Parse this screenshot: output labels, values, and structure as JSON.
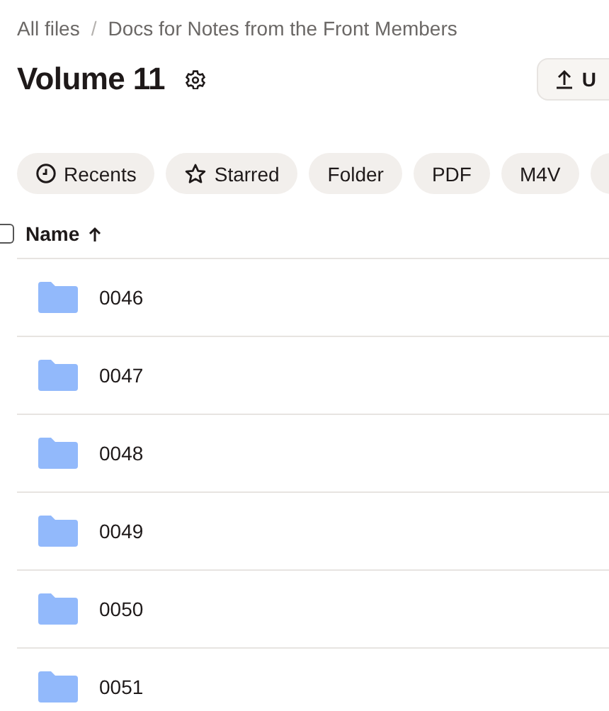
{
  "breadcrumb": {
    "separator": "/",
    "items": [
      "All files",
      "Docs for Notes from the Front Members"
    ]
  },
  "title": "Volume 11",
  "upload_button": {
    "label": "U"
  },
  "filters": [
    {
      "label": "Recents",
      "kind": "recent"
    },
    {
      "label": "Starred",
      "kind": "star"
    },
    {
      "label": "Folder",
      "kind": "plain"
    },
    {
      "label": "PDF",
      "kind": "plain"
    },
    {
      "label": "M4V",
      "kind": "plain"
    },
    {
      "kind": "cut"
    }
  ],
  "table": {
    "select_all": {
      "checked": false
    },
    "column": "Name",
    "sort_ascending": true,
    "rows": [
      {
        "name": "0046"
      },
      {
        "name": "0047"
      },
      {
        "name": "0048"
      },
      {
        "name": "0049"
      },
      {
        "name": "0050"
      },
      {
        "name": "0051"
      }
    ]
  }
}
